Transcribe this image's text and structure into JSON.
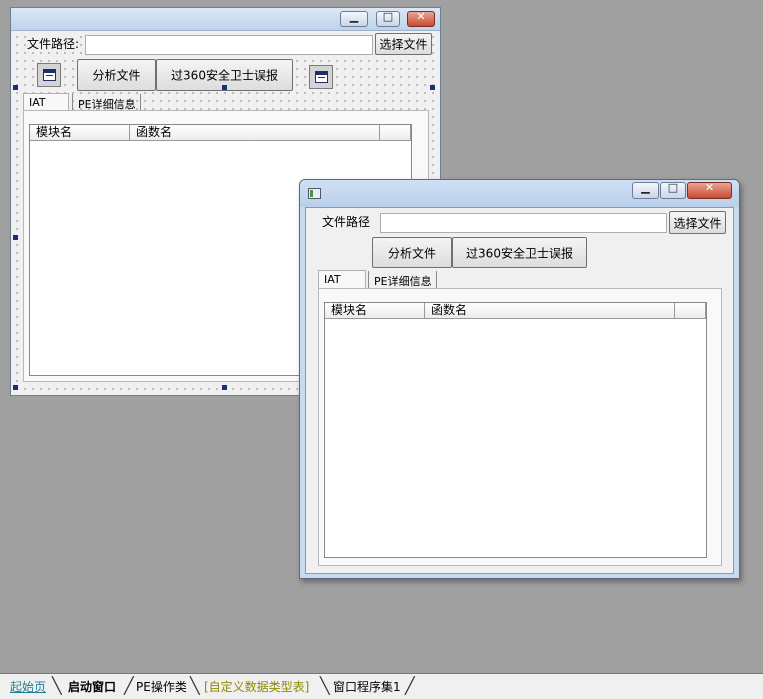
{
  "form": {
    "file_path_label": "文件路径:",
    "file_path_value": "",
    "choose_file_button": "选择文件",
    "analyze_button": "分析文件",
    "bypass_button": "过360安全卫士误报",
    "tabs": [
      {
        "label": "IAT",
        "active": true
      },
      {
        "label": "PE详细信息",
        "active": false
      }
    ],
    "columns": [
      "模块名",
      "函数名"
    ]
  },
  "runtime": {
    "file_path_label": "文件路径",
    "file_path_value": "",
    "choose_file_button": "选择文件",
    "analyze_button": "分析文件",
    "bypass_button": "过360安全卫士误报",
    "tabs": [
      {
        "label": "IAT",
        "active": true
      },
      {
        "label": "PE详细信息",
        "active": false
      }
    ],
    "columns": [
      "模块名",
      "函数名"
    ]
  },
  "window_buttons": {
    "minimize": "▁",
    "maximize": "□",
    "close": "✕"
  },
  "bottom_tabs": [
    {
      "label": "起始页",
      "color": "#1f7f8f",
      "bold": false
    },
    {
      "label": "启动窗口",
      "color": "#000000",
      "bold": true
    },
    {
      "label": "PE操作类",
      "color": "#000000",
      "bold": false
    },
    {
      "label": "[自定义数据类型表]",
      "color": "#8a8a00",
      "bold": false
    },
    {
      "label": "窗口程序集1",
      "color": "#000000",
      "bold": false
    }
  ],
  "colors": {
    "workspace": "#a0a0a0",
    "selection_handle": "#1a2f7a"
  }
}
